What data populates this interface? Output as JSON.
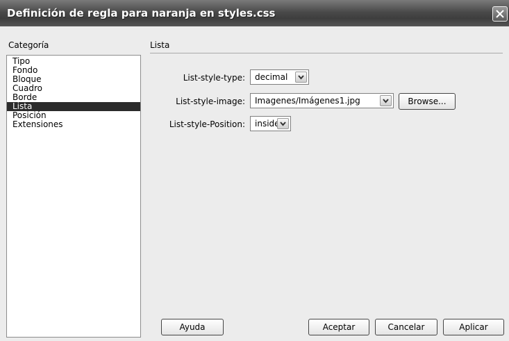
{
  "window": {
    "title": "Definición de regla para naranja en styles.css"
  },
  "categories": {
    "label": "Categoría",
    "items": [
      "Tipo",
      "Fondo",
      "Bloque",
      "Cuadro",
      "Borde",
      "Lista",
      "Posición",
      "Extensiones"
    ],
    "selected": "Lista"
  },
  "section": {
    "title": "Lista",
    "fields": {
      "type_label": "List-style-type:",
      "type_value": "decimal",
      "image_label": "List-style-image:",
      "image_value": "Imagenes/Imágenes1.jpg",
      "browse_label": "Browse...",
      "position_label": "List-style-Position:",
      "position_value": "inside"
    }
  },
  "buttons": {
    "help": "Ayuda",
    "ok": "Aceptar",
    "cancel": "Cancelar",
    "apply": "Aplicar"
  },
  "icons": [
    "close-icon",
    "chevron-down-icon"
  ]
}
